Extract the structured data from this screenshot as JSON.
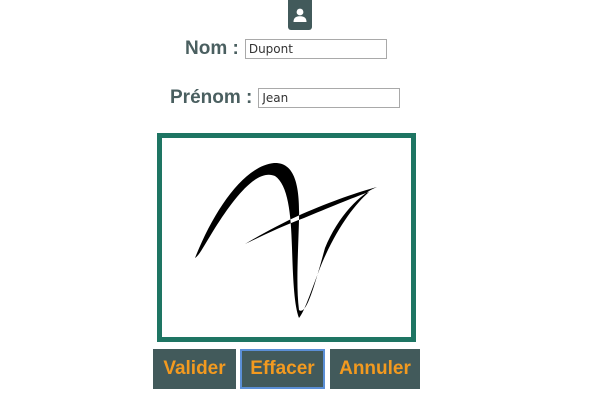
{
  "header": {
    "icon": "user-icon",
    "badge_color": "#425a5b"
  },
  "form": {
    "nom": {
      "label": "Nom :",
      "value": "Dupont"
    },
    "prenom": {
      "label": "Prénom :",
      "value": "Jean"
    }
  },
  "signature": {
    "border_color": "#1e7563"
  },
  "buttons": {
    "valider": "Valider",
    "effacer": "Effacer",
    "annuler": "Annuler",
    "background": "#425a5b",
    "text_color": "#f39a1f"
  }
}
